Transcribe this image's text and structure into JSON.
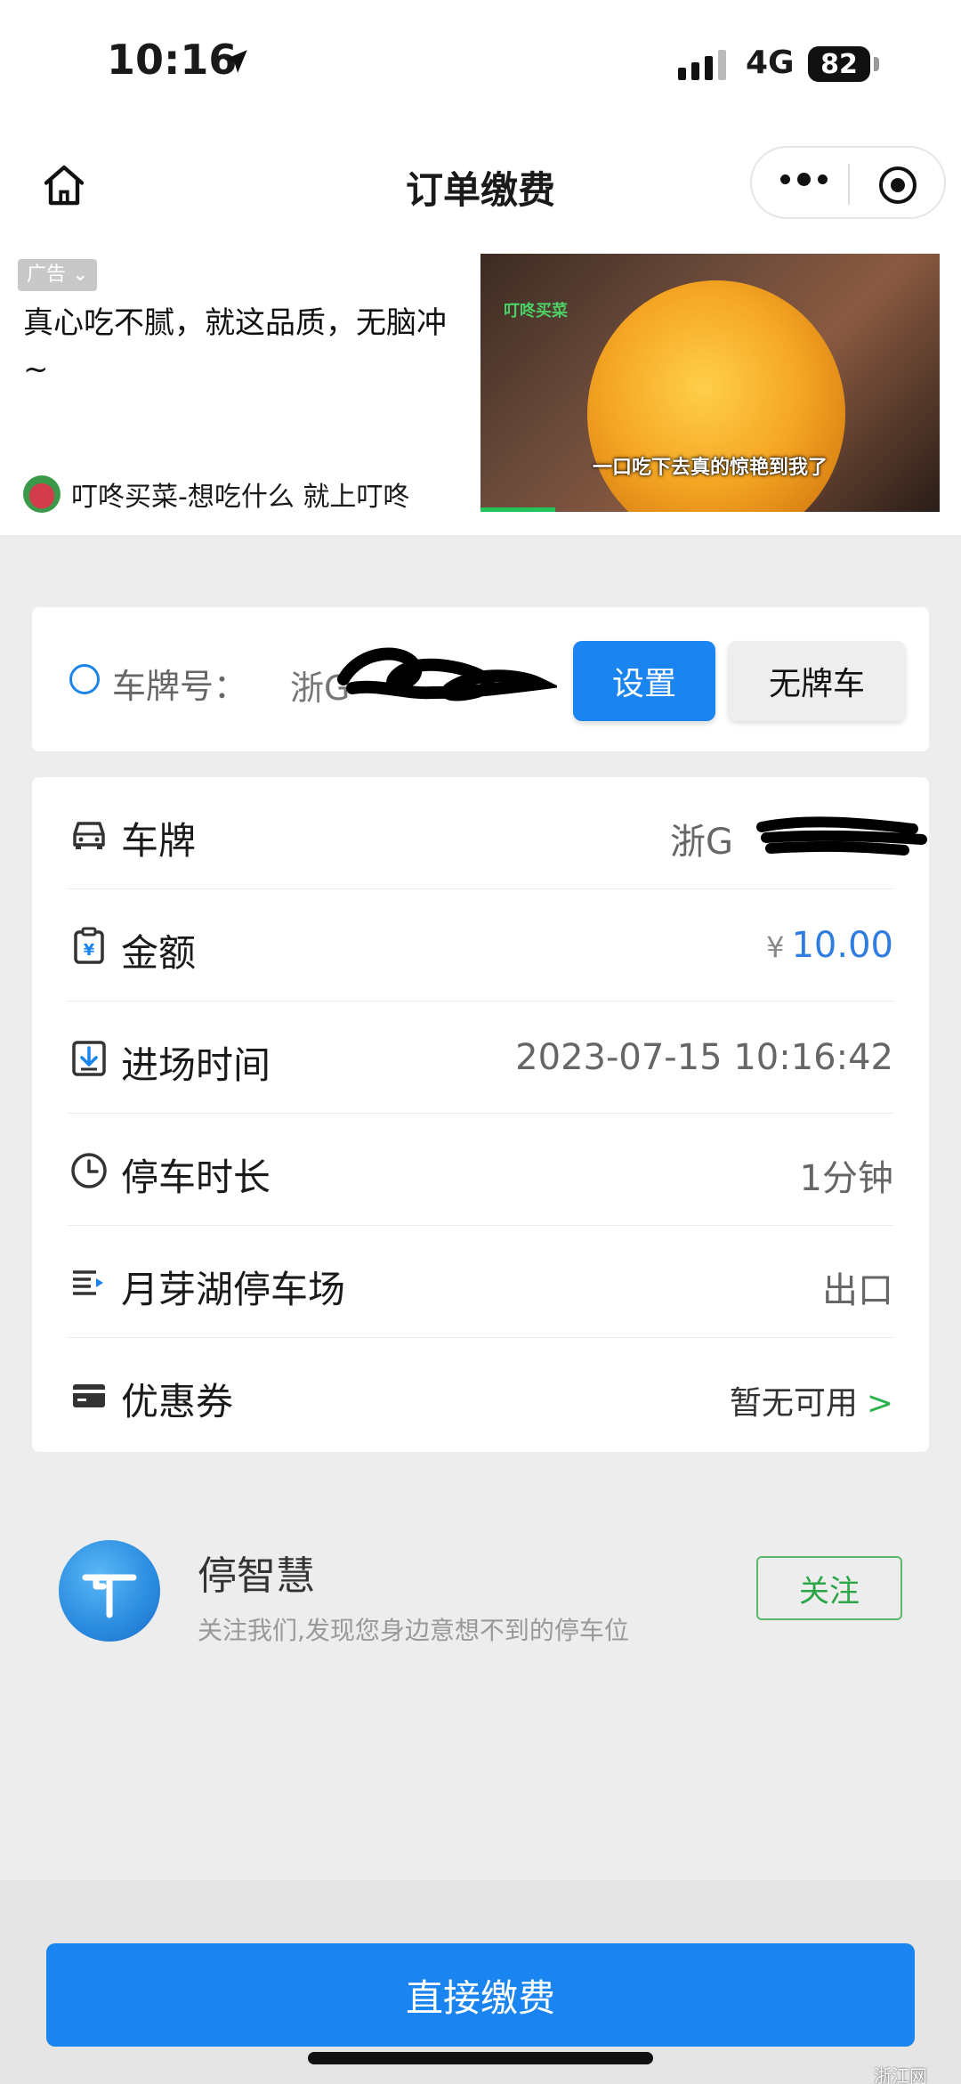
{
  "status_bar": {
    "time": "10:16",
    "network": "4G",
    "battery": "82"
  },
  "nav": {
    "title": "订单缴费"
  },
  "ad": {
    "badge": "广告",
    "text": "真心吃不腻，就这品质，无脑冲~",
    "brand": "叮咚买菜-想吃什么 就上叮咚",
    "image_logo": "叮咚买菜",
    "image_caption": "一口吃下去真的惊艳到我了"
  },
  "plate": {
    "label": "车牌号：",
    "value": "浙G",
    "set_label": "设置",
    "no_plate_label": "无牌车"
  },
  "info": {
    "rows": [
      {
        "label": "车牌",
        "value": "浙G"
      },
      {
        "label": "金额",
        "currency": "¥",
        "value": "10.00"
      },
      {
        "label": "进场时间",
        "value": "2023-07-15 10:16:42"
      },
      {
        "label": "停车时长",
        "value": "1分钟"
      },
      {
        "label": "月芽湖停车场",
        "value": "出口"
      },
      {
        "label": "优惠券",
        "value": "暂无可用",
        "chevron": ">"
      }
    ]
  },
  "follow": {
    "name": "停智慧",
    "desc": "关注我们,发现您身边意想不到的停车位",
    "button": "关注"
  },
  "pay": {
    "label": "直接缴费"
  },
  "watermark": "浙江网",
  "colors": {
    "primary": "#1a84f0",
    "green": "#2aa548",
    "amount": "#2f7de0"
  }
}
